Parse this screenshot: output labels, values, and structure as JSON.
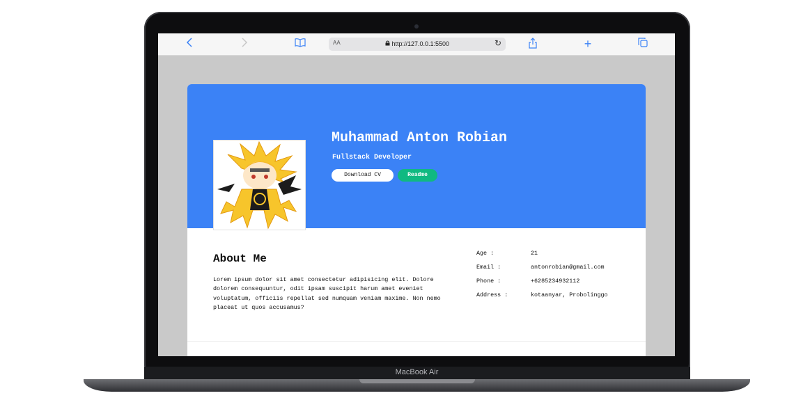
{
  "device": {
    "label": "MacBook Air"
  },
  "browser": {
    "url": "http://127.0.0.1:5500",
    "aa_label": "AA",
    "icons": [
      "back-icon",
      "forward-icon",
      "bookmarks-icon",
      "lock-icon",
      "reload-icon",
      "share-icon",
      "new-tab-icon",
      "tabs-icon"
    ]
  },
  "profile": {
    "name": "Muhammad Anton Robian",
    "role": "Fullstack Developer",
    "download_label": "Download CV",
    "readme_label": "Readme"
  },
  "about": {
    "title": "About Me",
    "text": "Lorem ipsum dolor sit amet consectetur adipisicing elit. Dolore dolorem consequuntur, odit ipsam suscipit harum amet eveniet voluptatum, officiis repellat sed numquam veniam maxime. Non nemo placeat ut quos accusamus?"
  },
  "info": [
    {
      "label": "Age :",
      "value": "21"
    },
    {
      "label": "Email :",
      "value": "antonrobian@gmail.com"
    },
    {
      "label": "Phone :",
      "value": "+6285234932112"
    },
    {
      "label": "Address :",
      "value": "kotaanyar, Probolinggo"
    }
  ],
  "colors": {
    "hero": "#3b82f6",
    "readme": "#10b981",
    "toolbar_accent": "#3b82f6"
  }
}
